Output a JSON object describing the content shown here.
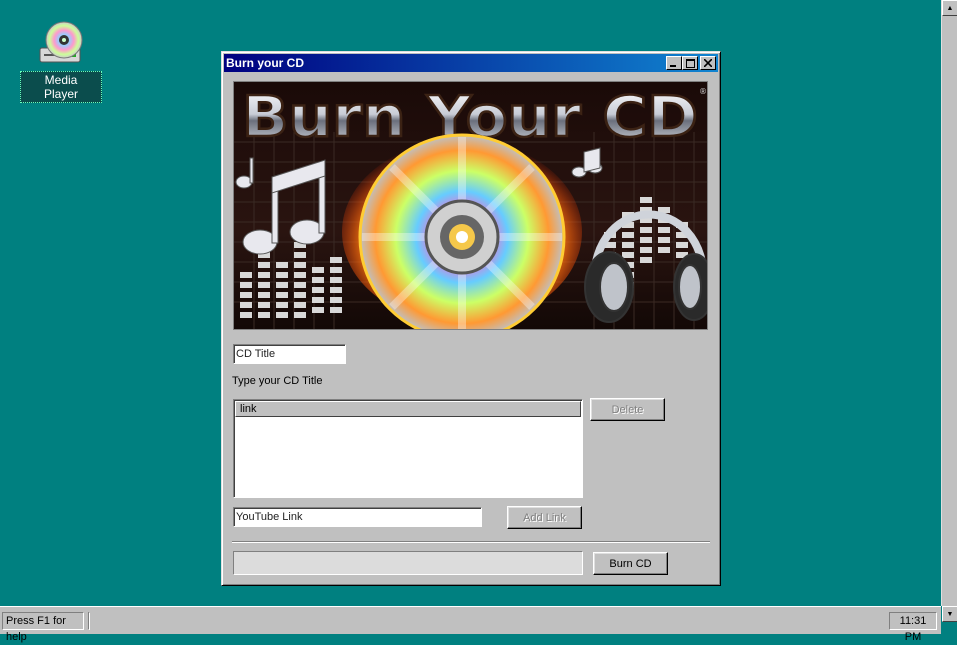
{
  "desktop": {
    "icon_label": "Media Player",
    "icon": "cd-drive-icon",
    "background_color": "#008080"
  },
  "window": {
    "title": "Burn your CD",
    "controls": [
      "minimize-icon",
      "maximize-icon",
      "close-icon"
    ],
    "banner": {
      "heading": "Burn Your CD",
      "trademark": "®"
    },
    "cd_title_placeholder": "CD Title",
    "cd_title_hint": "Type your CD Title",
    "list_header": "link",
    "delete_label": "Delete",
    "youtube_placeholder": "YouTube Link",
    "add_link_label": "Add Link",
    "burn_label": "Burn CD",
    "progress": 0
  },
  "statusbar": {
    "help_text": "Press F1 for help",
    "clock": "11:31 PM"
  },
  "colors": {
    "titlebar_start": "#000080",
    "titlebar_end": "#1084d0",
    "face": "#c0c0c0"
  }
}
